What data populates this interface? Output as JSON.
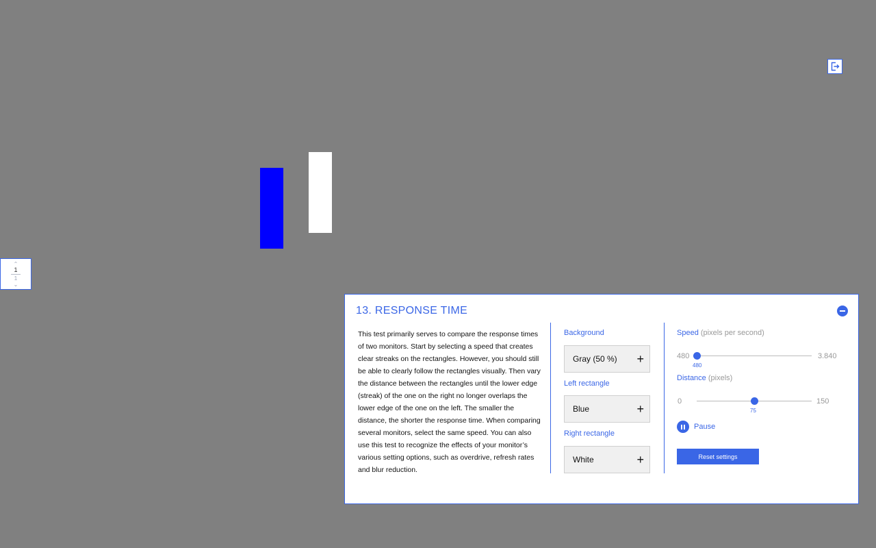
{
  "colors": {
    "background": "#808080",
    "left_rectangle": "#0000ff",
    "right_rectangle": "#ffffff",
    "accent": "#3a66e6"
  },
  "pager": {
    "current": "1",
    "total": "1"
  },
  "icons": {
    "exit": "exit-icon",
    "collapse": "minus-circle-icon",
    "pager_up": "chevron-up-icon",
    "pager_down": "chevron-down-icon",
    "pause": "pause-icon",
    "add": "plus-icon"
  },
  "panel": {
    "title": "13. RESPONSE TIME",
    "description": "This test primarily serves to compare the response times of two monitors. Start by selecting a speed that creates clear streaks on the rectangles. However, you should still be able to clearly follow the rectangles visually. Then vary the distance between the rectangles until the lower edge (streak) of the one on the right no longer overlaps the lower edge of the one on the left. The smaller the distance, the shorter the response time. When comparing several monitors, select the same speed. You can also use this test to recognize the effects of your monitor’s various setting options, such as overdrive, refresh rates and blur reduction.",
    "background": {
      "label": "Background",
      "value": "Gray (50 %)"
    },
    "left_rectangle": {
      "label": "Left rectangle",
      "value": "Blue"
    },
    "right_rectangle": {
      "label": "Right rectangle",
      "value": "White"
    },
    "speed": {
      "label": "Speed",
      "unit": "(pixels per second)",
      "min": "480",
      "max": "3.840",
      "value": "480",
      "min_num": 480,
      "max_num": 3840,
      "value_num": 480
    },
    "distance": {
      "label": "Distance",
      "unit": "(pixels)",
      "min": "0",
      "max": "150",
      "value": "75",
      "min_num": 0,
      "max_num": 150,
      "value_num": 75
    },
    "pause_label": "Pause",
    "reset_label": "Reset settings"
  }
}
